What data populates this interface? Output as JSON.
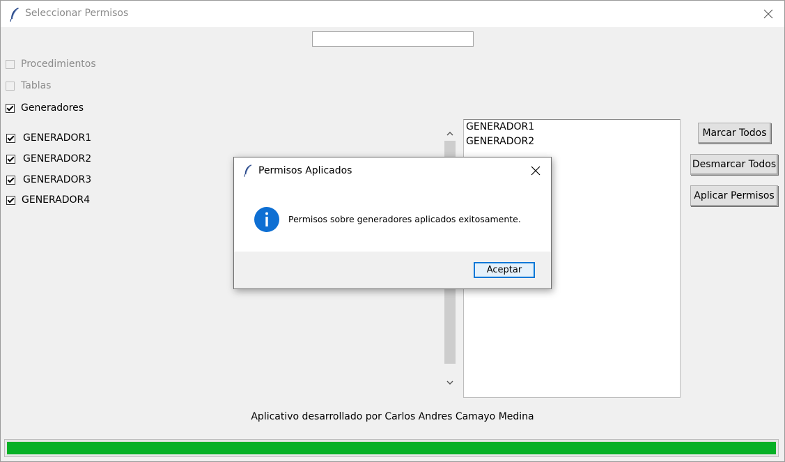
{
  "window": {
    "title": "Seleccionar Permisos"
  },
  "search": {
    "value": ""
  },
  "categories": [
    {
      "label": "Procedimientos",
      "checked": false,
      "disabled": true
    },
    {
      "label": "Tablas",
      "checked": false,
      "disabled": true
    },
    {
      "label": "Generadores",
      "checked": true,
      "disabled": false
    }
  ],
  "generators": [
    {
      "label": "GENERADOR1",
      "checked": true
    },
    {
      "label": "GENERADOR2",
      "checked": true
    },
    {
      "label": "GENERADOR3",
      "checked": true
    },
    {
      "label": "GENERADOR4",
      "checked": true
    }
  ],
  "selected_list": [
    "GENERADOR1",
    "GENERADOR2"
  ],
  "buttons": {
    "mark_all": "Marcar Todos",
    "unmark_all": "Desmarcar Todos",
    "apply": "Aplicar Permisos"
  },
  "footer": {
    "credit": "Aplicativo desarrollado por Carlos Andres Camayo Medina"
  },
  "progress": {
    "value": 1.0,
    "color": "#06b025"
  },
  "dialog": {
    "title": "Permisos Aplicados",
    "message": "Permisos sobre generadores aplicados exitosamente.",
    "ok_label": "Aceptar",
    "icon": "info-icon"
  },
  "icons": {
    "app": "feather-icon",
    "close": "close-icon",
    "scroll_up": "chevron-up-icon",
    "scroll_down": "chevron-down-icon"
  }
}
